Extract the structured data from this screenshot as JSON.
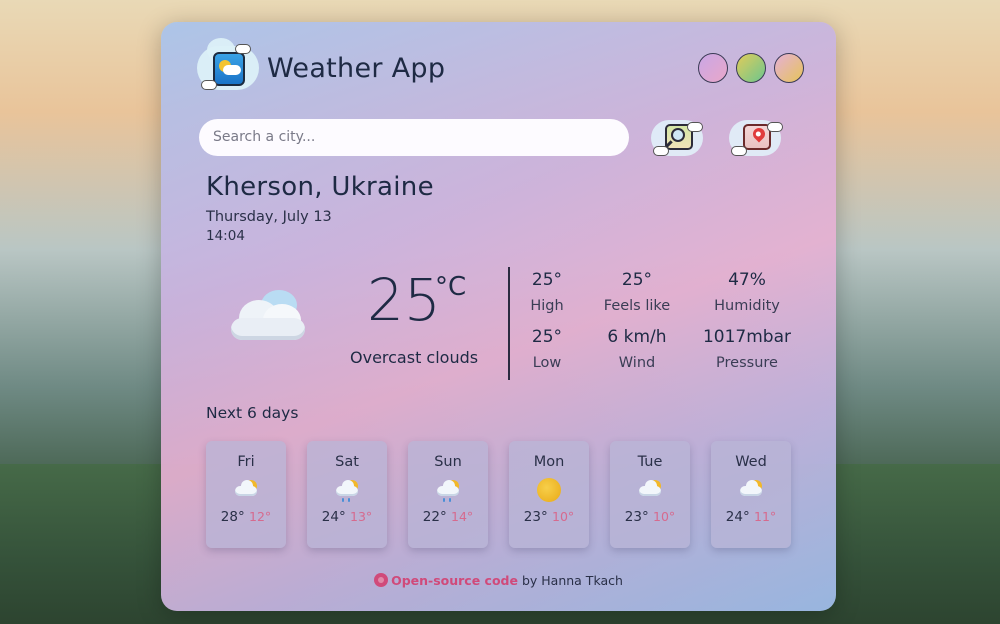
{
  "app": {
    "title": "Weather App"
  },
  "search": {
    "placeholder": "Search a city..."
  },
  "location": {
    "city": "Kherson, Ukraine",
    "date": "Thursday, July 13",
    "time": "14:04"
  },
  "current": {
    "temp": "25",
    "unit": "°C",
    "description": "Overcast clouds",
    "icon": "overcast-clouds-icon"
  },
  "stats": {
    "high": {
      "value": "25°",
      "label": "High"
    },
    "feels_like": {
      "value": "25°",
      "label": "Feels like"
    },
    "humidity": {
      "value": "47%",
      "label": "Humidity"
    },
    "low": {
      "value": "25°",
      "label": "Low"
    },
    "wind": {
      "value": "6 km/h",
      "label": "Wind"
    },
    "pressure": {
      "value": "1017mbar",
      "label": "Pressure"
    }
  },
  "forecast": {
    "label": "Next 6 days",
    "days": [
      {
        "day": "Fri",
        "hi": "28°",
        "lo": "12°",
        "icon": "partly-cloudy-icon"
      },
      {
        "day": "Sat",
        "hi": "24°",
        "lo": "13°",
        "icon": "sun-rain-icon"
      },
      {
        "day": "Sun",
        "hi": "22°",
        "lo": "14°",
        "icon": "sun-rain-icon"
      },
      {
        "day": "Mon",
        "hi": "23°",
        "lo": "10°",
        "icon": "sun-icon"
      },
      {
        "day": "Tue",
        "hi": "23°",
        "lo": "10°",
        "icon": "partly-cloudy-icon"
      },
      {
        "day": "Wed",
        "hi": "24°",
        "lo": "11°",
        "icon": "partly-cloudy-icon"
      }
    ]
  },
  "footer": {
    "link": "Open-source code",
    "by": "by Hanna Tkach"
  },
  "colors": {
    "accent": "#d04a7a",
    "text": "#1e2a44"
  }
}
